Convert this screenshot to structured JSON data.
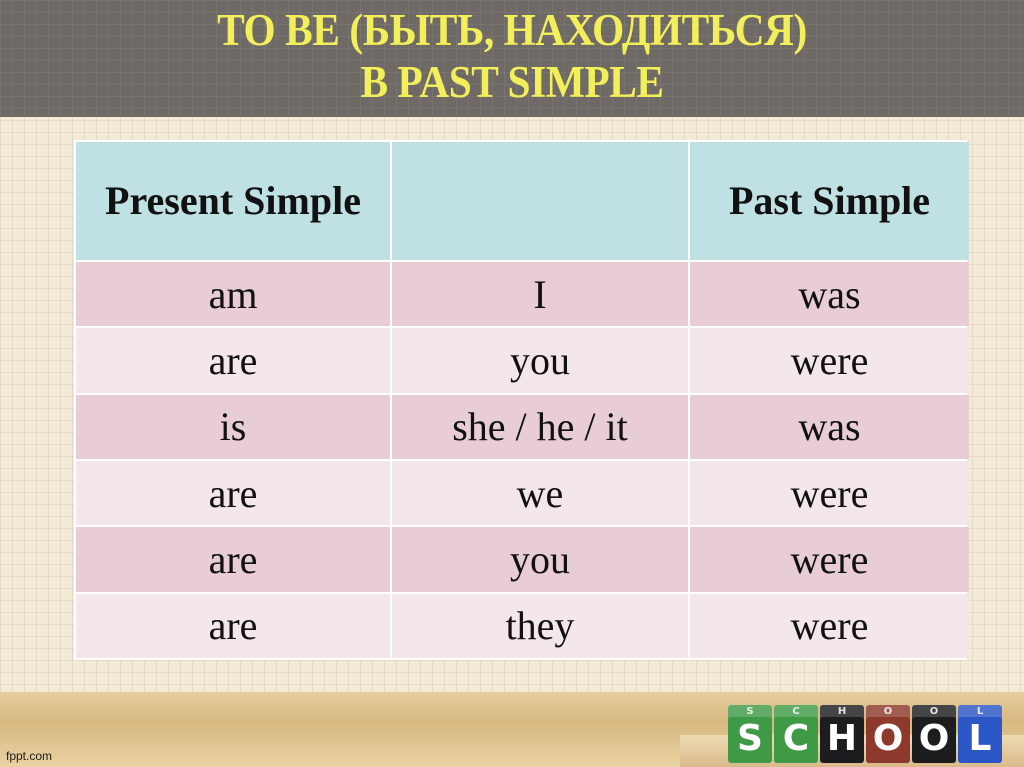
{
  "title": {
    "line1": "TO BE (БЫТЬ, НАХОДИТЬСЯ)",
    "line2": "В PAST SIMPLE"
  },
  "table": {
    "headers": [
      "Present Simple",
      "",
      "Past Simple"
    ],
    "rows": [
      {
        "present": "am",
        "pronoun": "I",
        "past": "was"
      },
      {
        "present": "are",
        "pronoun": "you",
        "past": "were"
      },
      {
        "present": "is",
        "pronoun": "she / he / it",
        "past": "was"
      },
      {
        "present": "are",
        "pronoun": "we",
        "past": "were"
      },
      {
        "present": "are",
        "pronoun": "you",
        "past": "were"
      },
      {
        "present": "are",
        "pronoun": "they",
        "past": "were"
      }
    ]
  },
  "footer": {
    "site": "fppt.com",
    "blocks": [
      {
        "letter": "S",
        "color": "#3f9a45"
      },
      {
        "letter": "C",
        "color": "#3f9a45"
      },
      {
        "letter": "H",
        "color": "#1d1d1f"
      },
      {
        "letter": "O",
        "color": "#8d3a2c"
      },
      {
        "letter": "O",
        "color": "#1d1d1f"
      },
      {
        "letter": "L",
        "color": "#2a56c6"
      }
    ]
  },
  "colors": {
    "title_text": "#f2ef5a",
    "title_band": "#6f6a66",
    "header_cell": "#bfe1e3",
    "row_dark": "#e8cdd5",
    "row_light": "#f3e7ea"
  }
}
